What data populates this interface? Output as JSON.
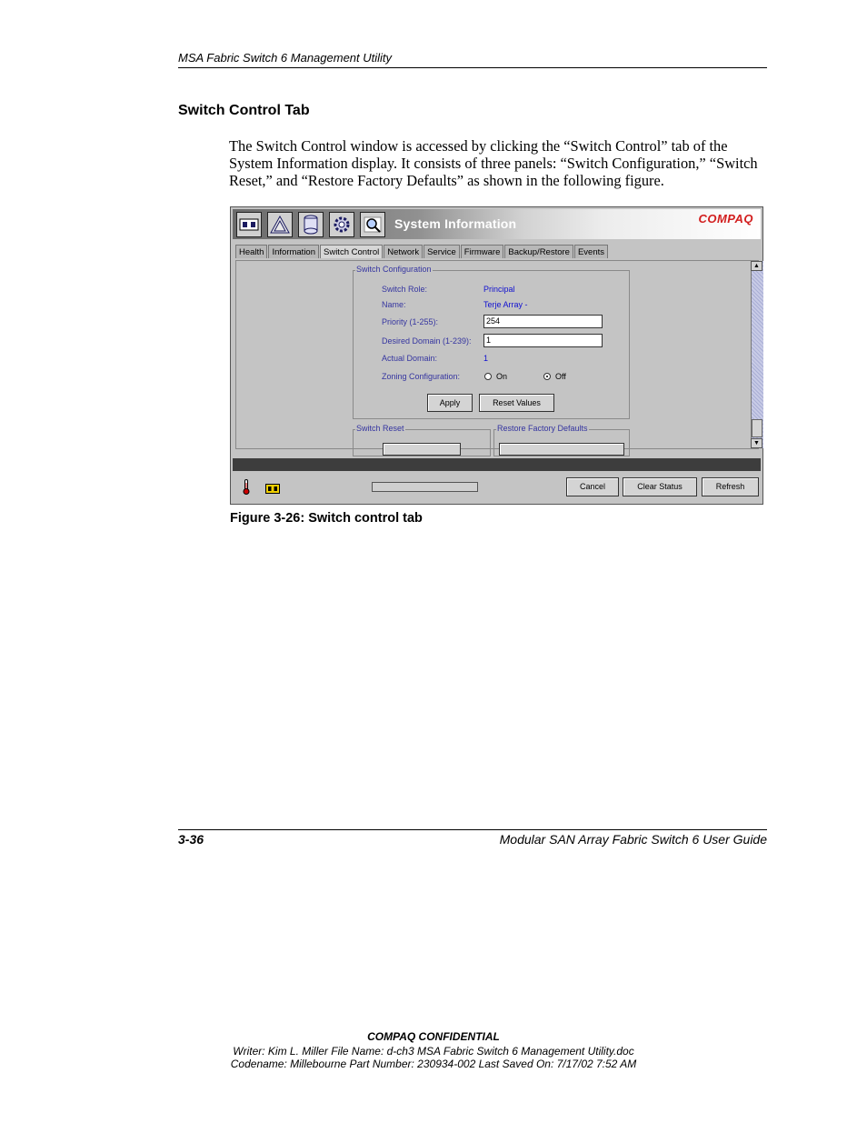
{
  "header": {
    "text": "MSA Fabric Switch 6 Management Utility"
  },
  "section": {
    "title": "Switch Control Tab"
  },
  "body": {
    "paragraph": "The Switch Control window is accessed by clicking the “Switch Control” tab of the System Information display. It consists of three panels: “Switch Configuration,” “Switch Reset,” and “Restore Factory Defaults” as shown in the following figure."
  },
  "screenshot": {
    "window_title": "System Information",
    "logo": "COMPAQ",
    "toolbar_icons": [
      "switch-icon",
      "fabric-icon",
      "storage-icon",
      "gear-icon",
      "search-icon"
    ],
    "tabs": [
      {
        "label": "Health"
      },
      {
        "label": "Information"
      },
      {
        "label": "Switch Control"
      },
      {
        "label": "Network"
      },
      {
        "label": "Service"
      },
      {
        "label": "Firmware"
      },
      {
        "label": "Backup/Restore"
      },
      {
        "label": "Events"
      }
    ],
    "active_tab": "Switch Control",
    "switch_config": {
      "legend": "Switch Configuration",
      "role_label": "Switch Role:",
      "role_value": "Principal",
      "name_label": "Name:",
      "name_value": "Terje Array -",
      "priority_label": "Priority (1-255):",
      "priority_value": "254",
      "desired_label": "Desired Domain (1-239):",
      "desired_value": "1",
      "actual_label": "Actual Domain:",
      "actual_value": "1",
      "zoning_label": "Zoning Configuration:",
      "zoning_on": "On",
      "zoning_off": "Off",
      "zoning_selected": "Off",
      "apply": "Apply",
      "reset_values": "Reset Values"
    },
    "switch_reset": {
      "legend": "Switch Reset"
    },
    "restore": {
      "legend": "Restore Factory Defaults"
    },
    "footer_buttons": {
      "cancel": "Cancel",
      "clear_status": "Clear Status",
      "refresh": "Refresh"
    },
    "status_icons": [
      "thermometer-icon",
      "switch-status-icon"
    ]
  },
  "figure": {
    "caption": "Figure 3-26:  Switch control tab"
  },
  "footer": {
    "page_number": "3-36",
    "guide_title": "Modular SAN Array Fabric Switch 6 User Guide",
    "confidential": "COMPAQ CONFIDENTIAL",
    "line1": "Writer: Kim L. Miller File Name: d-ch3 MSA Fabric Switch 6 Management Utility.doc",
    "line2": "Codename: Millebourne Part Number: 230934-002 Last Saved On: 7/17/02 7:52 AM"
  }
}
